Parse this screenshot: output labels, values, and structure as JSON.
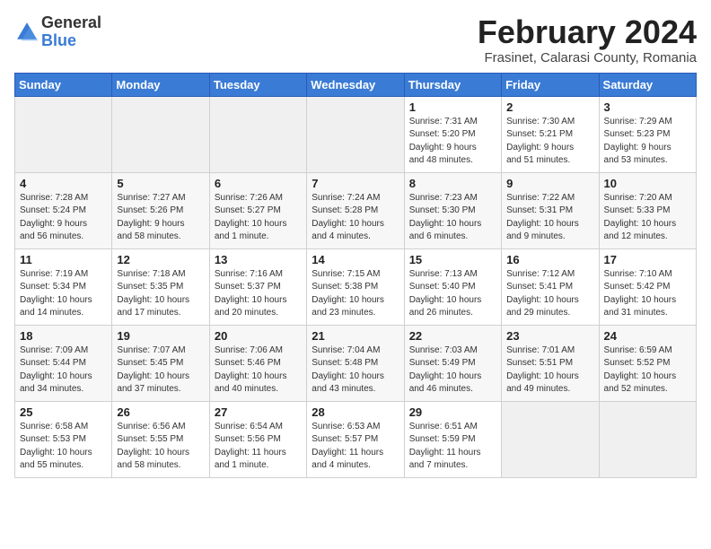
{
  "logo": {
    "general": "General",
    "blue": "Blue"
  },
  "header": {
    "title": "February 2024",
    "subtitle": "Frasinet, Calarasi County, Romania"
  },
  "weekdays": [
    "Sunday",
    "Monday",
    "Tuesday",
    "Wednesday",
    "Thursday",
    "Friday",
    "Saturday"
  ],
  "weeks": [
    [
      {
        "day": "",
        "info": ""
      },
      {
        "day": "",
        "info": ""
      },
      {
        "day": "",
        "info": ""
      },
      {
        "day": "",
        "info": ""
      },
      {
        "day": "1",
        "info": "Sunrise: 7:31 AM\nSunset: 5:20 PM\nDaylight: 9 hours\nand 48 minutes."
      },
      {
        "day": "2",
        "info": "Sunrise: 7:30 AM\nSunset: 5:21 PM\nDaylight: 9 hours\nand 51 minutes."
      },
      {
        "day": "3",
        "info": "Sunrise: 7:29 AM\nSunset: 5:23 PM\nDaylight: 9 hours\nand 53 minutes."
      }
    ],
    [
      {
        "day": "4",
        "info": "Sunrise: 7:28 AM\nSunset: 5:24 PM\nDaylight: 9 hours\nand 56 minutes."
      },
      {
        "day": "5",
        "info": "Sunrise: 7:27 AM\nSunset: 5:26 PM\nDaylight: 9 hours\nand 58 minutes."
      },
      {
        "day": "6",
        "info": "Sunrise: 7:26 AM\nSunset: 5:27 PM\nDaylight: 10 hours\nand 1 minute."
      },
      {
        "day": "7",
        "info": "Sunrise: 7:24 AM\nSunset: 5:28 PM\nDaylight: 10 hours\nand 4 minutes."
      },
      {
        "day": "8",
        "info": "Sunrise: 7:23 AM\nSunset: 5:30 PM\nDaylight: 10 hours\nand 6 minutes."
      },
      {
        "day": "9",
        "info": "Sunrise: 7:22 AM\nSunset: 5:31 PM\nDaylight: 10 hours\nand 9 minutes."
      },
      {
        "day": "10",
        "info": "Sunrise: 7:20 AM\nSunset: 5:33 PM\nDaylight: 10 hours\nand 12 minutes."
      }
    ],
    [
      {
        "day": "11",
        "info": "Sunrise: 7:19 AM\nSunset: 5:34 PM\nDaylight: 10 hours\nand 14 minutes."
      },
      {
        "day": "12",
        "info": "Sunrise: 7:18 AM\nSunset: 5:35 PM\nDaylight: 10 hours\nand 17 minutes."
      },
      {
        "day": "13",
        "info": "Sunrise: 7:16 AM\nSunset: 5:37 PM\nDaylight: 10 hours\nand 20 minutes."
      },
      {
        "day": "14",
        "info": "Sunrise: 7:15 AM\nSunset: 5:38 PM\nDaylight: 10 hours\nand 23 minutes."
      },
      {
        "day": "15",
        "info": "Sunrise: 7:13 AM\nSunset: 5:40 PM\nDaylight: 10 hours\nand 26 minutes."
      },
      {
        "day": "16",
        "info": "Sunrise: 7:12 AM\nSunset: 5:41 PM\nDaylight: 10 hours\nand 29 minutes."
      },
      {
        "day": "17",
        "info": "Sunrise: 7:10 AM\nSunset: 5:42 PM\nDaylight: 10 hours\nand 31 minutes."
      }
    ],
    [
      {
        "day": "18",
        "info": "Sunrise: 7:09 AM\nSunset: 5:44 PM\nDaylight: 10 hours\nand 34 minutes."
      },
      {
        "day": "19",
        "info": "Sunrise: 7:07 AM\nSunset: 5:45 PM\nDaylight: 10 hours\nand 37 minutes."
      },
      {
        "day": "20",
        "info": "Sunrise: 7:06 AM\nSunset: 5:46 PM\nDaylight: 10 hours\nand 40 minutes."
      },
      {
        "day": "21",
        "info": "Sunrise: 7:04 AM\nSunset: 5:48 PM\nDaylight: 10 hours\nand 43 minutes."
      },
      {
        "day": "22",
        "info": "Sunrise: 7:03 AM\nSunset: 5:49 PM\nDaylight: 10 hours\nand 46 minutes."
      },
      {
        "day": "23",
        "info": "Sunrise: 7:01 AM\nSunset: 5:51 PM\nDaylight: 10 hours\nand 49 minutes."
      },
      {
        "day": "24",
        "info": "Sunrise: 6:59 AM\nSunset: 5:52 PM\nDaylight: 10 hours\nand 52 minutes."
      }
    ],
    [
      {
        "day": "25",
        "info": "Sunrise: 6:58 AM\nSunset: 5:53 PM\nDaylight: 10 hours\nand 55 minutes."
      },
      {
        "day": "26",
        "info": "Sunrise: 6:56 AM\nSunset: 5:55 PM\nDaylight: 10 hours\nand 58 minutes."
      },
      {
        "day": "27",
        "info": "Sunrise: 6:54 AM\nSunset: 5:56 PM\nDaylight: 11 hours\nand 1 minute."
      },
      {
        "day": "28",
        "info": "Sunrise: 6:53 AM\nSunset: 5:57 PM\nDaylight: 11 hours\nand 4 minutes."
      },
      {
        "day": "29",
        "info": "Sunrise: 6:51 AM\nSunset: 5:59 PM\nDaylight: 11 hours\nand 7 minutes."
      },
      {
        "day": "",
        "info": ""
      },
      {
        "day": "",
        "info": ""
      }
    ]
  ]
}
